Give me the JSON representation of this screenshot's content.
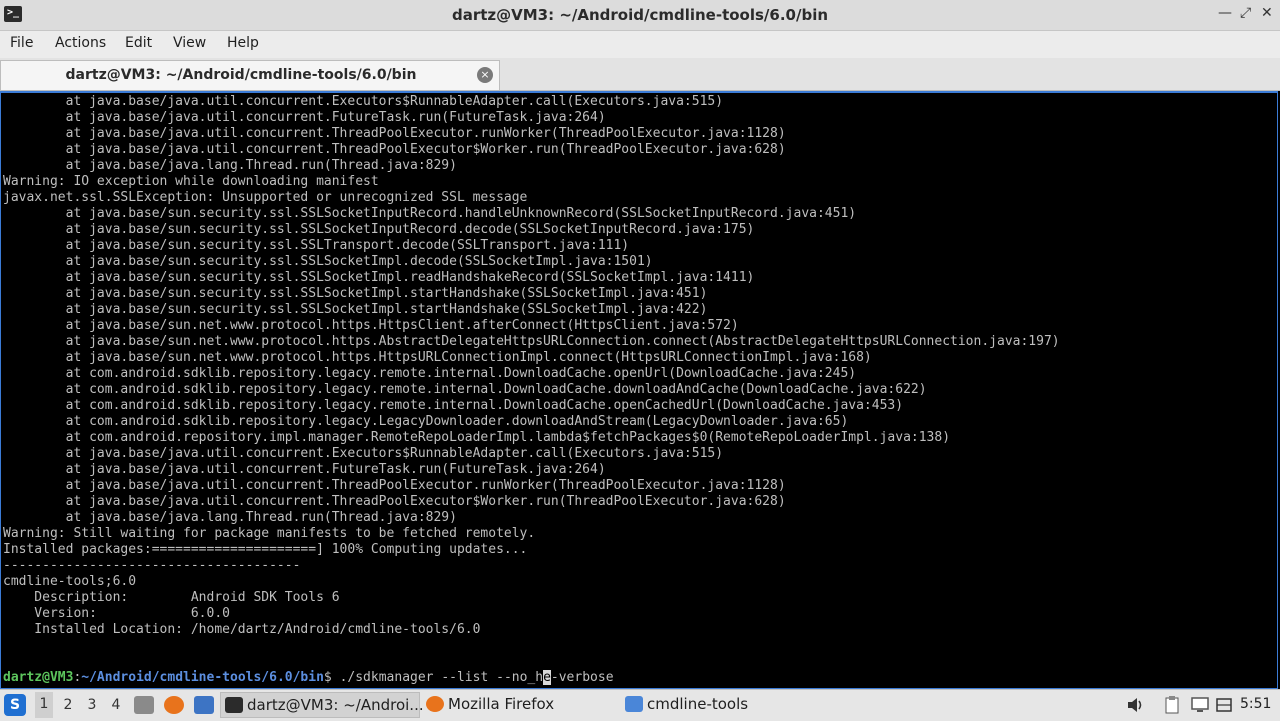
{
  "window": {
    "title": "dartz@VM3: ~/Android/cmdline-tools/6.0/bin"
  },
  "menu": [
    "File",
    "Actions",
    "Edit",
    "View",
    "Help"
  ],
  "tab": {
    "label": "dartz@VM3: ~/Android/cmdline-tools/6.0/bin",
    "close_icon": "×"
  },
  "terminal": {
    "lines": [
      "        at java.base/java.util.concurrent.Executors$RunnableAdapter.call(Executors.java:515)",
      "        at java.base/java.util.concurrent.FutureTask.run(FutureTask.java:264)",
      "        at java.base/java.util.concurrent.ThreadPoolExecutor.runWorker(ThreadPoolExecutor.java:1128)",
      "        at java.base/java.util.concurrent.ThreadPoolExecutor$Worker.run(ThreadPoolExecutor.java:628)",
      "        at java.base/java.lang.Thread.run(Thread.java:829)",
      "Warning: IO exception while downloading manifest",
      "javax.net.ssl.SSLException: Unsupported or unrecognized SSL message",
      "        at java.base/sun.security.ssl.SSLSocketInputRecord.handleUnknownRecord(SSLSocketInputRecord.java:451)",
      "        at java.base/sun.security.ssl.SSLSocketInputRecord.decode(SSLSocketInputRecord.java:175)",
      "        at java.base/sun.security.ssl.SSLTransport.decode(SSLTransport.java:111)",
      "        at java.base/sun.security.ssl.SSLSocketImpl.decode(SSLSocketImpl.java:1501)",
      "        at java.base/sun.security.ssl.SSLSocketImpl.readHandshakeRecord(SSLSocketImpl.java:1411)",
      "        at java.base/sun.security.ssl.SSLSocketImpl.startHandshake(SSLSocketImpl.java:451)",
      "        at java.base/sun.security.ssl.SSLSocketImpl.startHandshake(SSLSocketImpl.java:422)",
      "        at java.base/sun.net.www.protocol.https.HttpsClient.afterConnect(HttpsClient.java:572)",
      "        at java.base/sun.net.www.protocol.https.AbstractDelegateHttpsURLConnection.connect(AbstractDelegateHttpsURLConnection.java:197)",
      "        at java.base/sun.net.www.protocol.https.HttpsURLConnectionImpl.connect(HttpsURLConnectionImpl.java:168)",
      "        at com.android.sdklib.repository.legacy.remote.internal.DownloadCache.openUrl(DownloadCache.java:245)",
      "        at com.android.sdklib.repository.legacy.remote.internal.DownloadCache.downloadAndCache(DownloadCache.java:622)",
      "        at com.android.sdklib.repository.legacy.remote.internal.DownloadCache.openCachedUrl(DownloadCache.java:453)",
      "        at com.android.sdklib.repository.legacy.LegacyDownloader.downloadAndStream(LegacyDownloader.java:65)",
      "        at com.android.repository.impl.manager.RemoteRepoLoaderImpl.lambda$fetchPackages$0(RemoteRepoLoaderImpl.java:138)",
      "        at java.base/java.util.concurrent.Executors$RunnableAdapter.call(Executors.java:515)",
      "        at java.base/java.util.concurrent.FutureTask.run(FutureTask.java:264)",
      "        at java.base/java.util.concurrent.ThreadPoolExecutor.runWorker(ThreadPoolExecutor.java:1128)",
      "        at java.base/java.util.concurrent.ThreadPoolExecutor$Worker.run(ThreadPoolExecutor.java:628)",
      "        at java.base/java.lang.Thread.run(Thread.java:829)",
      "Warning: Still waiting for package manifests to be fetched remotely.",
      "Installed packages:=====================] 100% Computing updates...",
      "--------------------------------------",
      "cmdline-tools;6.0",
      "    Description:        Android SDK Tools 6",
      "    Version:            6.0.0",
      "    Installed Location: /home/dartz/Android/cmdline-tools/6.0",
      ""
    ],
    "prompt": {
      "user": "dartz@VM3",
      "sep": ":",
      "path": "~/Android/cmdline-tools/6.0/bin",
      "symbol": "$ ",
      "command_before": "./sdkmanager --list --no_h",
      "cursor_char": "e",
      "command_after": "-verbose"
    }
  },
  "taskbar": {
    "start_icon": "S",
    "workspaces": [
      "1",
      "2",
      "3",
      "4"
    ],
    "active_workspace": "1",
    "tasks": [
      {
        "label": "dartz@VM3: ~/Androi...",
        "icon": "terminal-icon"
      },
      {
        "label": "Mozilla Firefox",
        "icon": "firefox-icon"
      },
      {
        "label": "cmdline-tools",
        "icon": "folder-icon"
      }
    ],
    "clock": "5:51"
  },
  "colors": {
    "prompt_user": "#5dc55d",
    "prompt_path": "#5c8fe0",
    "terminal_text": "#bfbfbf",
    "accent_border": "#3b7bd6"
  }
}
